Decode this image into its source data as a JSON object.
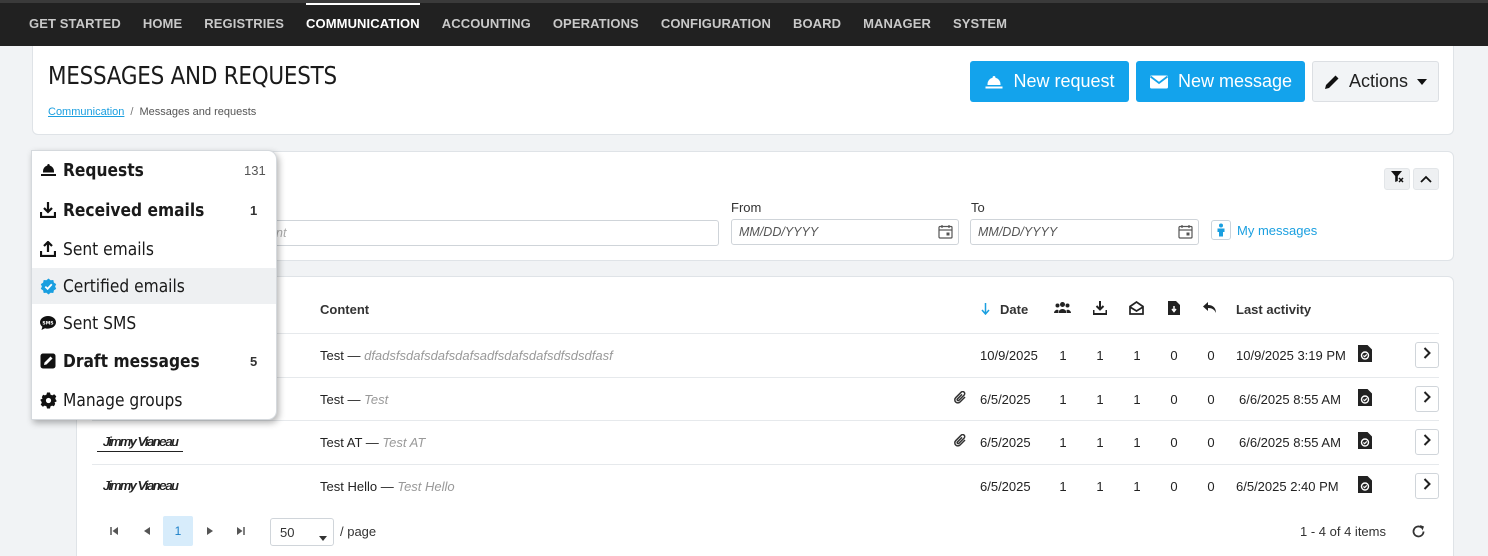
{
  "nav": {
    "items": [
      "GET STARTED",
      "HOME",
      "REGISTRIES",
      "COMMUNICATION",
      "ACCOUNTING",
      "OPERATIONS",
      "CONFIGURATION",
      "BOARD",
      "MANAGER",
      "SYSTEM"
    ],
    "active": "COMMUNICATION"
  },
  "header": {
    "title": "MESSAGES AND REQUESTS",
    "breadcrumb": {
      "link": "Communication",
      "separator": "/",
      "current": "Messages and requests"
    },
    "buttons": {
      "new_request": "New request",
      "new_message": "New message",
      "actions": "Actions"
    }
  },
  "filters": {
    "search_placeholder": "nt",
    "from_label": "From",
    "to_label": "To",
    "from_placeholder": "MM/DD/YYYY",
    "to_placeholder": "MM/DD/YYYY",
    "my_messages": "My messages"
  },
  "table": {
    "headers": {
      "content": "Content",
      "date": "Date",
      "last_activity": "Last activity"
    },
    "rows": [
      {
        "sender": "",
        "content": "Test",
        "sub": "dfadsfsdafsdafsdafsadfsdafsdafsdfsdsdfasf",
        "attachment": false,
        "date": "10/9/2025",
        "c1": "1",
        "c2": "1",
        "c3": "1",
        "c4": "0",
        "c5": "0",
        "last_activity": "10/9/2025 3:19 PM"
      },
      {
        "sender": "",
        "content": "Test",
        "sub": "Test",
        "attachment": true,
        "date": "6/5/2025",
        "c1": "1",
        "c2": "1",
        "c3": "1",
        "c4": "0",
        "c5": "0",
        "last_activity": "6/6/2025 8:55 AM"
      },
      {
        "sender": "Jimmy Vianeau",
        "content": "Test AT",
        "sub": "Test AT",
        "attachment": true,
        "date": "6/5/2025",
        "c1": "1",
        "c2": "1",
        "c3": "1",
        "c4": "0",
        "c5": "0",
        "last_activity": "6/6/2025 8:55 AM"
      },
      {
        "sender": "Jimmy Vianeau",
        "content": "Test Hello",
        "sub": "Test Hello",
        "attachment": false,
        "date": "6/5/2025",
        "c1": "1",
        "c2": "1",
        "c3": "1",
        "c4": "0",
        "c5": "0",
        "last_activity": "6/5/2025 2:40 PM"
      }
    ],
    "dash": "—"
  },
  "pager": {
    "current_page": "1",
    "per_page": "50",
    "per_page_label": "/ page",
    "items_label": "1 - 4 of 4 items"
  },
  "menu": {
    "items": [
      {
        "label": "Requests",
        "count": "131",
        "bold": true
      },
      {
        "label": "Received emails",
        "count": "1",
        "bold": true
      },
      {
        "label": "Sent emails",
        "count": "",
        "bold": false
      },
      {
        "label": "Certified emails",
        "count": "",
        "bold": false
      },
      {
        "label": "Sent SMS",
        "count": "",
        "bold": false
      },
      {
        "label": "Draft messages",
        "count": "5",
        "bold": true
      },
      {
        "label": "Manage groups",
        "count": "",
        "bold": false
      }
    ]
  },
  "colors": {
    "primary": "#13a3ec",
    "nav_bg": "#212121",
    "link": "#1a9fe0"
  }
}
